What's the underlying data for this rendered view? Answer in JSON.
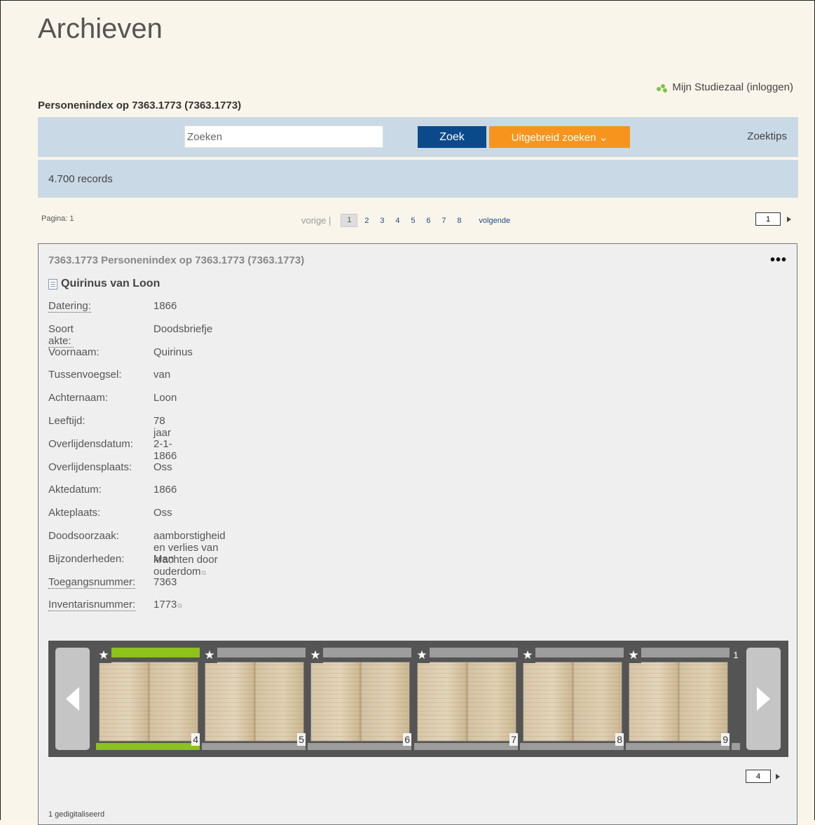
{
  "page": {
    "title": "Archieven",
    "subtitle": "Personenindex op 7363.1773 (7363.1773)",
    "studiezaal": "Mijn Studiezaal (inloggen)"
  },
  "search": {
    "placeholder": "Zoeken",
    "zoek_label": "Zoek",
    "uitgebreid_label": "Uitgebreid zoeken ⌄",
    "zoektips_label": "Zoektips"
  },
  "results": {
    "count_text": "4.700 records"
  },
  "pagination": {
    "page_label": "Pagina: 1",
    "prev_label": "vorige |",
    "pages": [
      "1",
      "2",
      "3",
      "4",
      "5",
      "6",
      "7",
      "8"
    ],
    "current": "1",
    "next_label": "volgende",
    "input_value": "1"
  },
  "record": {
    "header": "7363.1773 Personenindex op 7363.1773 (7363.1773)",
    "name": "Quirinus van Loon",
    "fields": [
      {
        "label": "Datering:",
        "value": "1866"
      },
      {
        "label": "Soort akte:",
        "value": "Doodsbriefje"
      },
      {
        "label": "Voornaam:",
        "value": "Quirinus"
      },
      {
        "label": "Tussenvoegsel:",
        "value": "van"
      },
      {
        "label": "Achternaam:",
        "value": "Loon"
      },
      {
        "label": "Leeftijd:",
        "value": "78 jaar"
      },
      {
        "label": "Overlijdensdatum:",
        "value": "2-1-1866"
      },
      {
        "label": "Overlijdensplaats:",
        "value": "Oss"
      },
      {
        "label": "Aktedatum:",
        "value": "1866"
      },
      {
        "label": "Akteplaats:",
        "value": "Oss"
      },
      {
        "label": "Doodsoorzaak:",
        "value": "aamborstigheid en verlies van krachten door ouderdom"
      },
      {
        "label": "Bijzonderheden:",
        "value": "Man"
      },
      {
        "label": "Toegangsnummer:",
        "value": "7363"
      },
      {
        "label": "Inventarisnummer:",
        "value": "1773"
      }
    ]
  },
  "viewer": {
    "thumbnails": [
      "4",
      "5",
      "6",
      "7",
      "8",
      "9"
    ],
    "partial_thumb_label": "1",
    "selected": "4",
    "page_input_value": "4",
    "digitized_text": "1 gedigitaliseerd"
  },
  "colors": {
    "zoek_button": "#0b4a8a",
    "uitgebreid_button": "#f7941d",
    "search_bar": "#c9d9e5",
    "selected_thumb": "#8cc21a"
  }
}
